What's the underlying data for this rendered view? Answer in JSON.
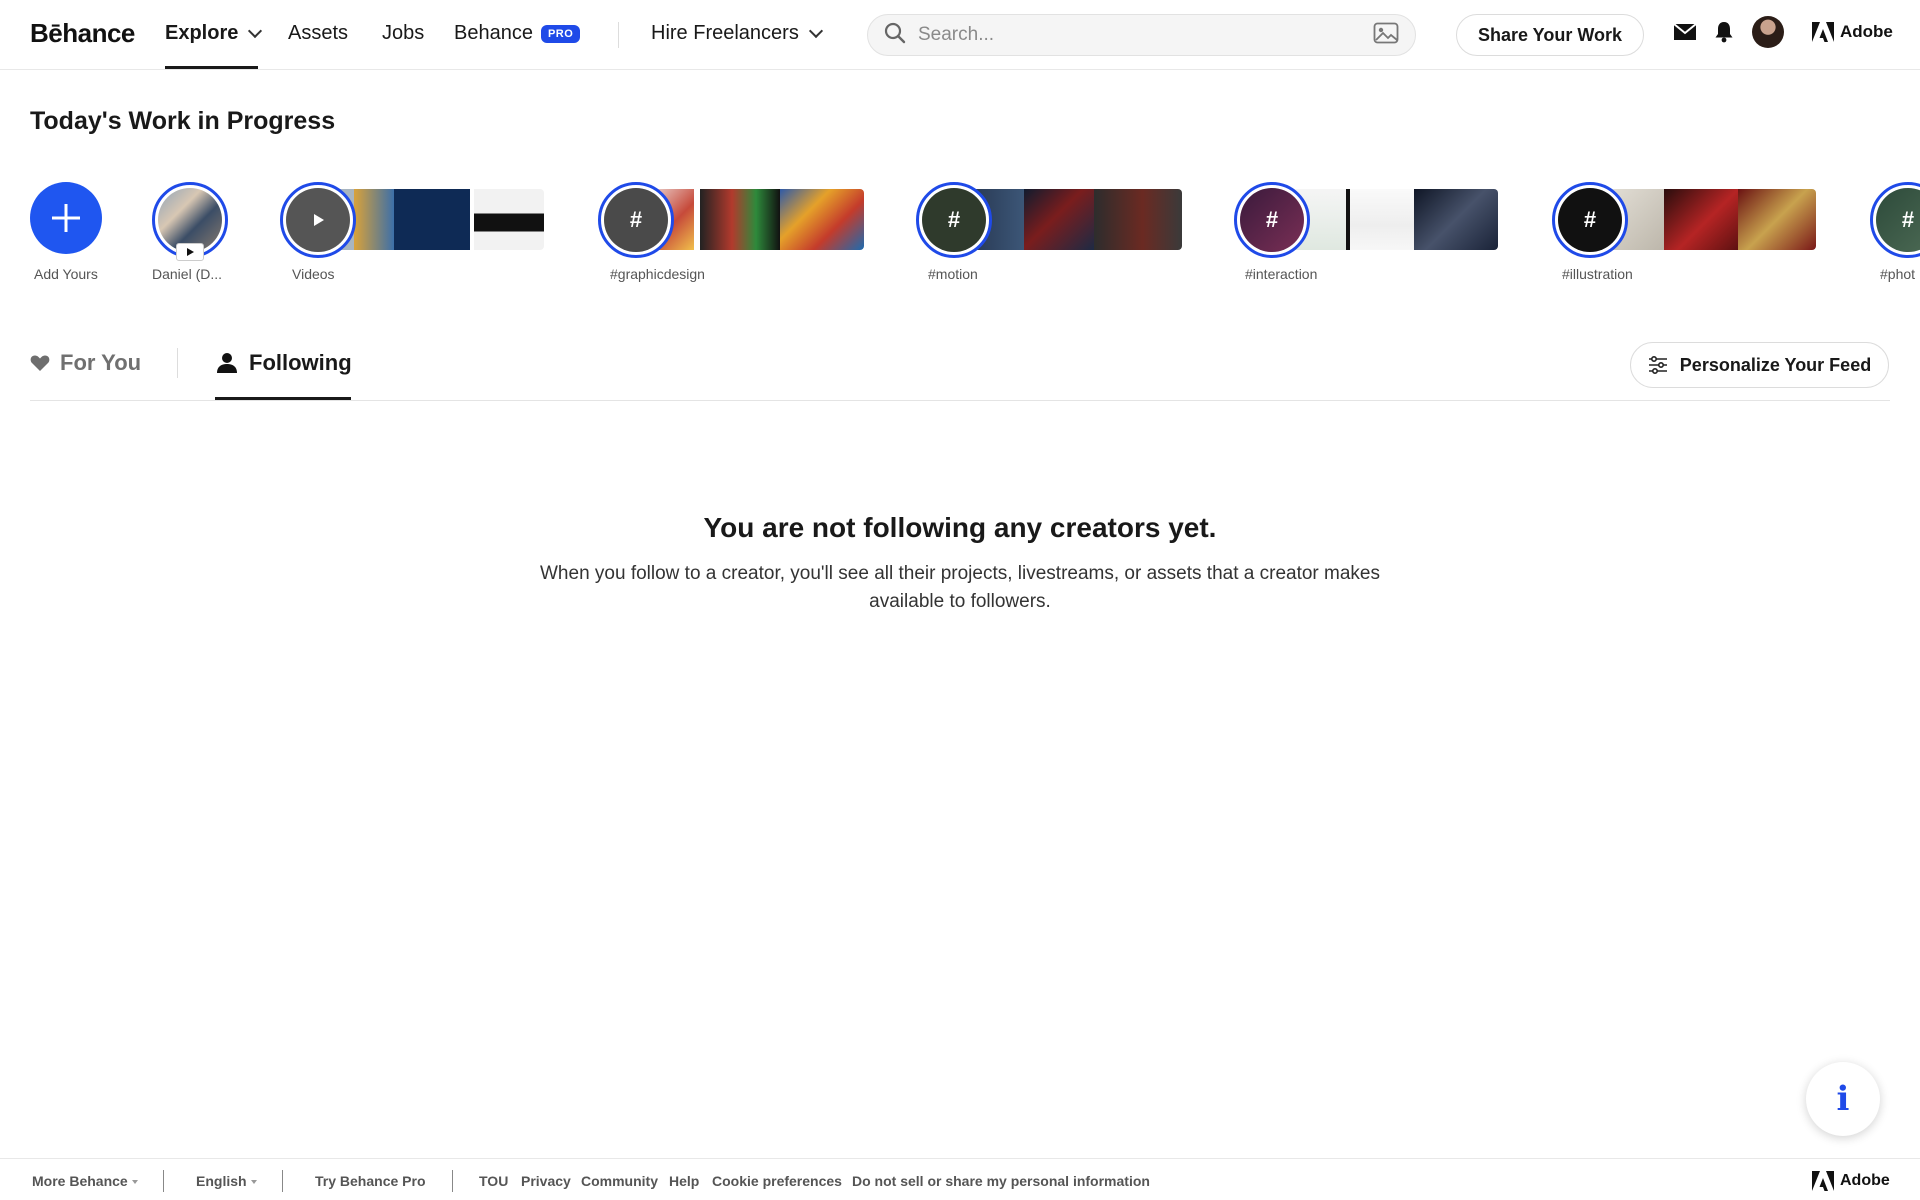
{
  "header": {
    "logo": "Bēhance",
    "nav": {
      "explore": "Explore",
      "assets": "Assets",
      "jobs": "Jobs",
      "behance": "Behance",
      "pro_badge": "PRO",
      "hire": "Hire Freelancers"
    },
    "search_placeholder": "Search...",
    "share_label": "Share Your Work",
    "adobe_label": "Adobe"
  },
  "wip": {
    "title": "Today's Work in Progress",
    "items": [
      {
        "label": "Add Yours"
      },
      {
        "label": "Daniel (D..."
      },
      {
        "label": "Videos"
      },
      {
        "label": "#graphicdesign"
      },
      {
        "label": "#motion"
      },
      {
        "label": "#interaction"
      },
      {
        "label": "#illustration"
      },
      {
        "label": "#phot"
      }
    ]
  },
  "tabs": {
    "for_you": "For You",
    "following": "Following",
    "personalize": "Personalize Your Feed"
  },
  "empty": {
    "title": "You are not following any creators yet.",
    "text": "When you follow to a creator, you'll see all their projects, livestreams, or assets that a creator makes available to followers."
  },
  "footer": {
    "more": "More Behance",
    "language": "English",
    "try_pro": "Try Behance Pro",
    "links": [
      "TOU",
      "Privacy",
      "Community",
      "Help",
      "Cookie preferences",
      "Do not sell or share my personal information"
    ],
    "adobe": "Adobe"
  },
  "colors": {
    "accent": "#1f4ae8",
    "add_button": "#1f56f0",
    "text": "#191919"
  }
}
